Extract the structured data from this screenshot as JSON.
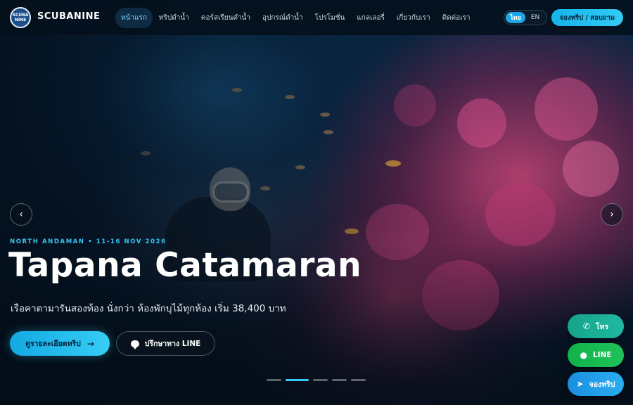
{
  "header": {
    "logo_text_top": "SCUBA",
    "logo_text_bottom": "NINE",
    "brand": "SCUBANINE",
    "menu": [
      {
        "label": "หน้าแรก",
        "active": true
      },
      {
        "label": "ทริปดำน้ำ",
        "active": false
      },
      {
        "label": "คอร์สเรียนดำน้ำ",
        "active": false
      },
      {
        "label": "อุปกรณ์ดำน้ำ",
        "active": false
      },
      {
        "label": "โปรโมชั่น",
        "active": false
      },
      {
        "label": "แกลเลอรี่",
        "active": false
      },
      {
        "label": "เกี่ยวกับเรา",
        "active": false
      },
      {
        "label": "ติดต่อเรา",
        "active": false
      }
    ],
    "lang": {
      "th": "ไทย",
      "en": "EN",
      "selected": "th"
    },
    "book_label": "จองทริป / สอบถาม"
  },
  "hero": {
    "eyebrow": "NORTH ANDAMAN • 11-16 NOV 2026",
    "title": "Tapana Catamaran",
    "subtitle": "เรือคาตามารันสองท้อง นั่งกว่า ห้องพักบุไม้ทุกห้อง เริ่ม 38,400 บาท",
    "cta_primary": "ดูรายละเอียดทริป",
    "cta_secondary": "ปรึกษาทาง LINE",
    "prev_icon": "‹",
    "next_icon": "›",
    "slide_count": 5,
    "active_slide": 2
  },
  "floating_actions": {
    "call": "โทร",
    "line": "LINE",
    "book": "จองทริป"
  },
  "colors": {
    "accent": "#36c9f4",
    "call": "#1aaa93",
    "line": "#16b84f",
    "book": "#229fe8"
  }
}
